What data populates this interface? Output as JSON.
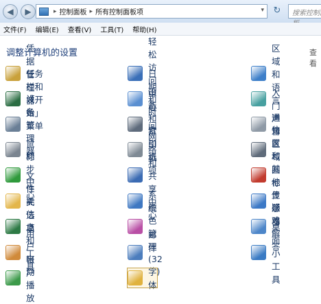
{
  "address_bar": {
    "crumbs": [
      "控制面板",
      "所有控制面板项"
    ],
    "search_placeholder": "搜索控制面板"
  },
  "menu": [
    "文件(F)",
    "编辑(E)",
    "查看(V)",
    "工具(T)",
    "帮助(H)"
  ],
  "heading": "调整计算机的设置",
  "view_label": "查看",
  "items": [
    {
      "label": "凭据管理器",
      "icon": "vault-icon",
      "color": "#c9a13b"
    },
    {
      "label": "轻松访问中心",
      "icon": "accessibility-icon",
      "color": "#3a6fb8"
    },
    {
      "label": "区域和语言",
      "icon": "globe-clock-icon",
      "color": "#3d7fc9"
    },
    {
      "label": "任务栏和「开始」菜单",
      "icon": "taskbar-icon",
      "color": "#2c6e44"
    },
    {
      "label": "日期和时间",
      "icon": "calendar-icon",
      "color": "#5a8fd1"
    },
    {
      "label": "入门",
      "icon": "getting-started-icon",
      "color": "#47a0a0"
    },
    {
      "label": "设备管理器",
      "icon": "device-manager-icon",
      "color": "#6a7f96"
    },
    {
      "label": "设备和打印机",
      "icon": "printer-icon",
      "color": "#5e6b7c"
    },
    {
      "label": "声音",
      "icon": "speaker-icon",
      "color": "#8f9aa6"
    },
    {
      "label": "鼠标",
      "icon": "mouse-icon",
      "color": "#7b8590"
    },
    {
      "label": "索引选项",
      "icon": "magnifier-icon",
      "color": "#7f8a95"
    },
    {
      "label": "通知区域图标",
      "icon": "tray-icon",
      "color": "#5f6b7a"
    },
    {
      "label": "同步中心",
      "icon": "sync-icon",
      "color": "#2f9a3c"
    },
    {
      "label": "网络和共享中心",
      "icon": "network-icon",
      "color": "#3b6bb3"
    },
    {
      "label": "位置和其他传感器",
      "icon": "sensor-icon",
      "color": "#c23b2e"
    },
    {
      "label": "文件夹选项",
      "icon": "folder-icon",
      "color": "#e3b64a"
    },
    {
      "label": "系统",
      "icon": "system-icon",
      "color": "#3f78c2"
    },
    {
      "label": "显示",
      "icon": "monitor-icon",
      "color": "#3c79c6"
    },
    {
      "label": "性能信息和工具",
      "icon": "performance-icon",
      "color": "#2d7a45"
    },
    {
      "label": "颜色管理",
      "icon": "color-icon",
      "color": "#b94fa5"
    },
    {
      "label": "疑难解答",
      "icon": "troubleshoot-icon",
      "color": "#4d86c9"
    },
    {
      "label": "用户帐户",
      "icon": "users-icon",
      "color": "#d08a3a"
    },
    {
      "label": "邮件 (32 位)",
      "icon": "mail-icon",
      "color": "#4c7dbd"
    },
    {
      "label": "桌面小工具",
      "icon": "gadgets-icon",
      "color": "#3a7bc4"
    },
    {
      "label": "自动播放",
      "icon": "autoplay-icon",
      "color": "#3c9a4a"
    },
    {
      "label": "字体",
      "icon": "fonts-icon",
      "color": "#e0b23e"
    }
  ],
  "selected_item": "字体"
}
